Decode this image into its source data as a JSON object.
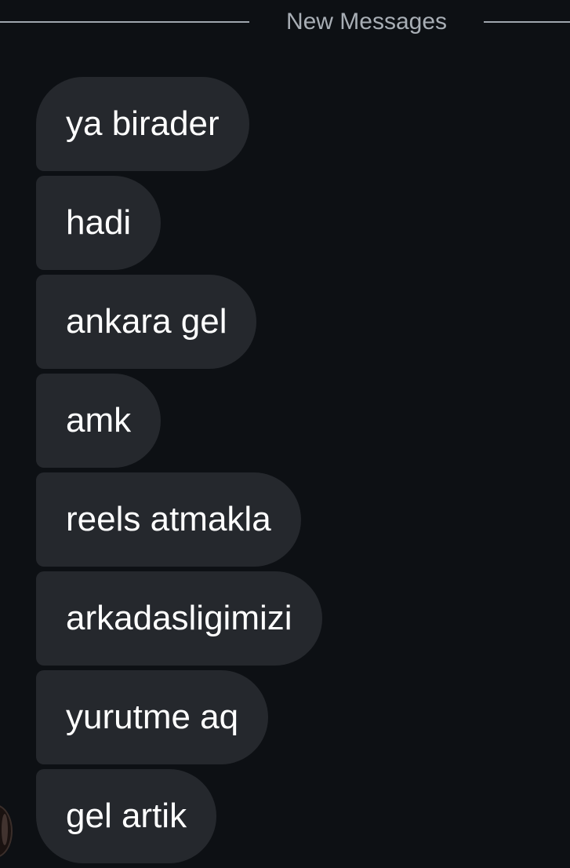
{
  "divider": {
    "label": "New Messages"
  },
  "messages": [
    {
      "text": "ya birader"
    },
    {
      "text": "hadi"
    },
    {
      "text": "ankara gel"
    },
    {
      "text": "amk"
    },
    {
      "text": "reels atmakla"
    },
    {
      "text": "arkadasligimizi"
    },
    {
      "text": "yurutme aq"
    },
    {
      "text": "gel artik"
    }
  ],
  "colors": {
    "background": "#0d1014",
    "bubble": "#25282d",
    "divider_text": "#a8aeb5",
    "divider_line": "#9fa6ae",
    "message_text": "#ffffff"
  },
  "icons": {
    "sender_avatar": "avatar"
  }
}
